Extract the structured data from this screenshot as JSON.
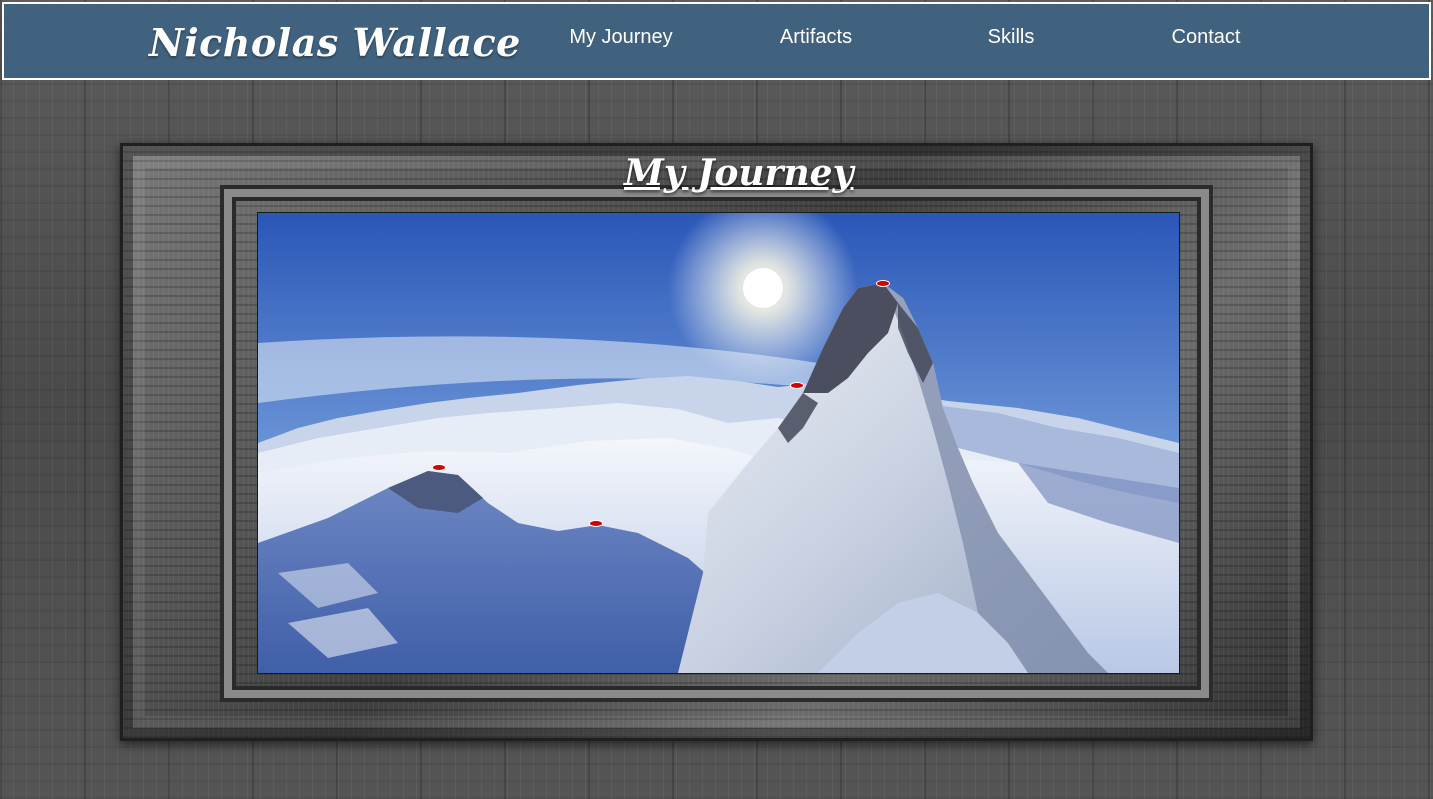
{
  "header": {
    "brand": "Nicholas Wallace",
    "nav": [
      "My Journey",
      "Artifacts",
      "Skills",
      "Contact"
    ]
  },
  "main": {
    "title": "My Journey",
    "image_subject": "snowy mountain peak panorama",
    "marker_color": "#d40000"
  },
  "colors": {
    "header_bg": "#41627f",
    "text": "#ffffff"
  }
}
